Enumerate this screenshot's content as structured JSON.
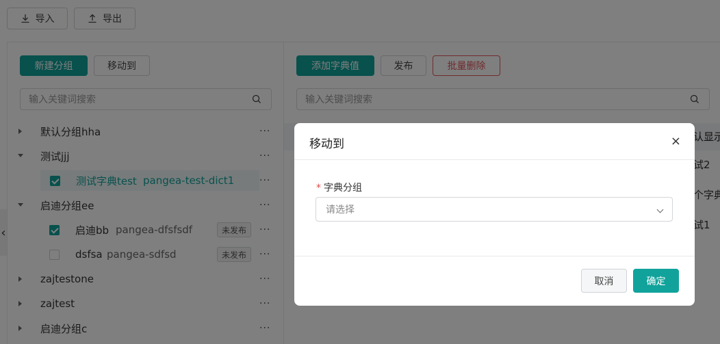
{
  "toolbar": {
    "import_label": "导入",
    "export_label": "导出"
  },
  "left": {
    "new_group_label": "新建分组",
    "move_to_label": "移动到",
    "search_placeholder": "输入关键词搜索",
    "tree": [
      {
        "label": "默认分组hha",
        "expanded": false
      },
      {
        "label": "测试jjj",
        "expanded": true
      },
      {
        "label": "测试字典test",
        "code": "pangea-test-dict1",
        "checked": true
      },
      {
        "label": "启迪分组ee",
        "expanded": true
      },
      {
        "label": "启迪bb",
        "code": "pangea-dfsfsdf",
        "checked": true,
        "status": "未发布"
      },
      {
        "label": "dsfsa",
        "code": "pangea-sdfsd",
        "checked": false,
        "status": "未发布"
      },
      {
        "label": "zajtestone",
        "expanded": false
      },
      {
        "label": "zajtest",
        "expanded": false
      },
      {
        "label": "启迪分组c",
        "expanded": false
      }
    ],
    "more_glyph": "···"
  },
  "right": {
    "add_value_label": "添加字典值",
    "publish_label": "发布",
    "batch_delete_label": "批量删除",
    "search_placeholder": "输入关键词搜索",
    "table_header_partial": "认显示",
    "rows_partial": [
      "试2",
      "个字典",
      "试1"
    ]
  },
  "collapse_glyph": "‹",
  "modal": {
    "title": "移动到",
    "close_glyph": "×",
    "required_mark": "*",
    "field_label": "字典分组",
    "select_placeholder": "请选择",
    "cancel_label": "取消",
    "confirm_label": "确定"
  },
  "colors": {
    "primary": "#11a39b",
    "danger": "#e0575d",
    "required": "#e04848"
  },
  "icons": [
    "download-icon",
    "upload-icon",
    "search-icon",
    "caret-right-icon",
    "caret-down-icon",
    "checkbox-icon",
    "close-icon",
    "chevron-down-icon"
  ]
}
